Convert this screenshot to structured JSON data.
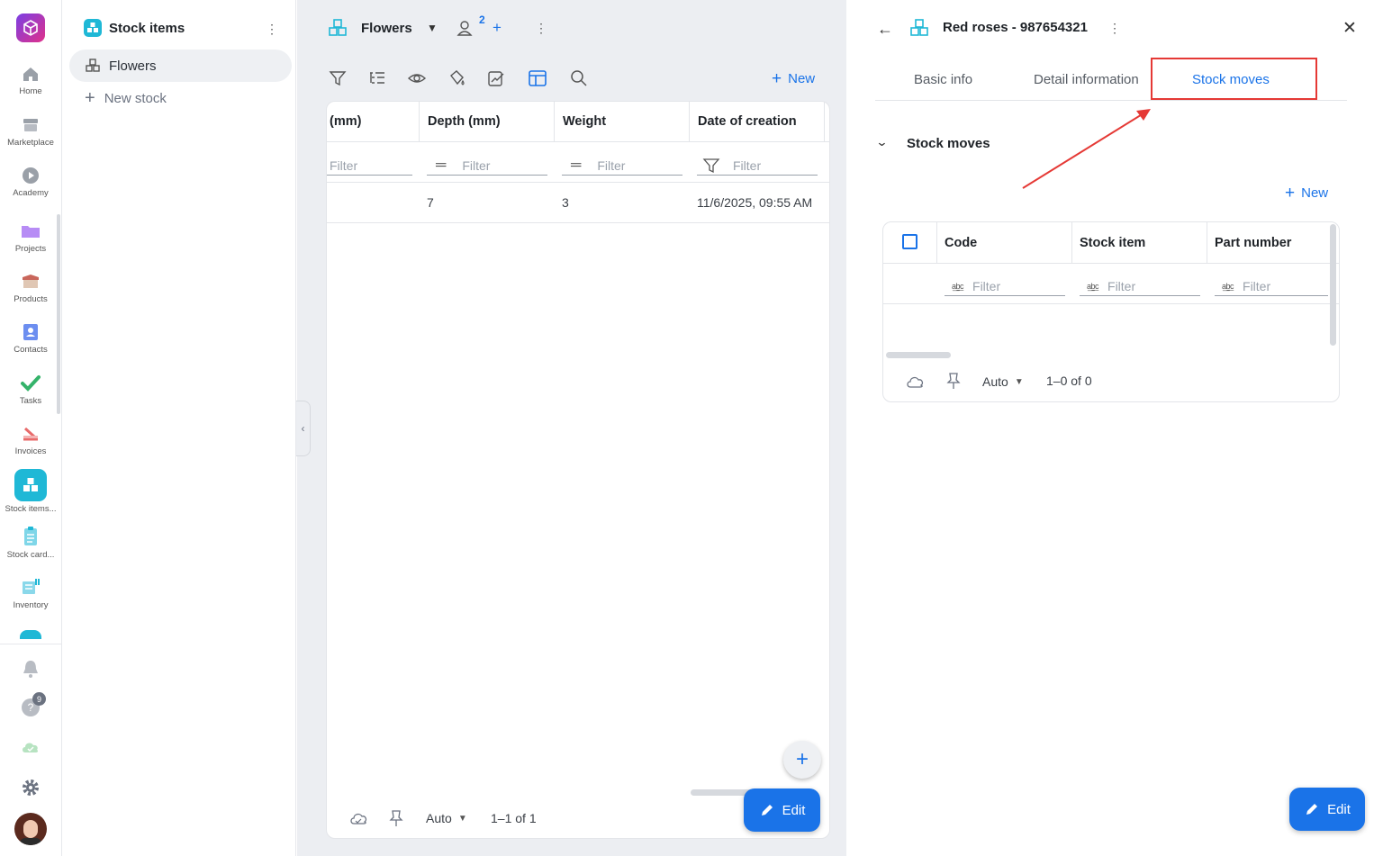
{
  "rail": {
    "items": [
      {
        "label": "Home",
        "icon": "home-icon"
      },
      {
        "label": "Marketplace",
        "icon": "store-icon"
      },
      {
        "label": "Academy",
        "icon": "play-icon"
      },
      {
        "label": "Projects",
        "icon": "folder-icon"
      },
      {
        "label": "Products",
        "icon": "box-icon"
      },
      {
        "label": "Contacts",
        "icon": "contacts-icon"
      },
      {
        "label": "Tasks",
        "icon": "check-icon"
      },
      {
        "label": "Invoices",
        "icon": "invoice-icon"
      },
      {
        "label": "Stock items...",
        "icon": "stock-items-icon"
      },
      {
        "label": "Stock card...",
        "icon": "clipboard-icon"
      },
      {
        "label": "Inventory",
        "icon": "inventory-icon"
      }
    ],
    "help_badge": "9"
  },
  "sidebar": {
    "title": "Stock items",
    "items": [
      {
        "label": "Flowers"
      },
      {
        "label": "New stock"
      }
    ]
  },
  "middle": {
    "view_title": "Flowers",
    "members_count": "2",
    "new_label": "New",
    "columns": [
      "(mm)",
      "Depth (mm)",
      "Weight",
      "Date of creation"
    ],
    "filter_placeholder": "Filter",
    "rows": [
      {
        "depth": "7",
        "weight": "3",
        "date": "11/6/2025, 09:55 AM"
      }
    ],
    "footer": {
      "mode": "Auto",
      "pagination": "1–1 of 1"
    },
    "edit_label": "Edit"
  },
  "right": {
    "record_title": "Red roses - 987654321",
    "tabs": [
      "Basic info",
      "Detail information",
      "Stock moves"
    ],
    "active_tab": "Stock moves",
    "section_title": "Stock moves",
    "new_label": "New",
    "columns": [
      "Code",
      "Stock item",
      "Part number"
    ],
    "filter_placeholder": "Filter",
    "footer": {
      "mode": "Auto",
      "pagination": "1–0 of 0"
    },
    "edit_label": "Edit"
  },
  "colors": {
    "accent": "#1a73e8",
    "brand": "#1fb8d6",
    "highlight": "#e53935"
  }
}
